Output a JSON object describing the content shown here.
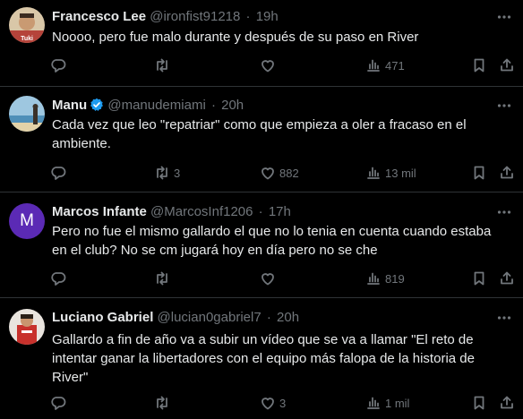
{
  "tweets": [
    {
      "name": "Francesco Lee",
      "handle": "@ironfist91218",
      "time": "19h",
      "verified": false,
      "text": "Noooo, pero fue malo durante y después de su paso en River",
      "replies": "",
      "retweets": "",
      "likes": "",
      "views": "471",
      "avatar": "photo-avatar"
    },
    {
      "name": "Manu",
      "handle": "@manudemiami",
      "time": "20h",
      "verified": true,
      "text": "Cada vez que leo \"repatriar\" como que empieza a oler a fracaso en el ambiente.",
      "replies": "",
      "retweets": "3",
      "likes": "882",
      "views": "13 mil",
      "avatar": "beach-avatar"
    },
    {
      "name": "Marcos Infante",
      "handle": "@MarcosInf1206",
      "time": "17h",
      "verified": false,
      "text": "Pero no fue el mismo gallardo el que no lo tenia en cuenta cuando estaba en el club? No se cm jugará hoy en día pero no se che",
      "replies": "",
      "retweets": "",
      "likes": "",
      "views": "819",
      "avatar": "letter-avatar",
      "avatar_letter": "M",
      "avatar_color": "#5b2ab5"
    },
    {
      "name": "Luciano Gabriel",
      "handle": "@lucian0gabriel7",
      "time": "20h",
      "verified": false,
      "text": "Gallardo a fin de año va a subir un vídeo que se va a llamar \"El reto de intentar ganar la libertadores con el equipo más falopa de la historia de River\"",
      "replies": "",
      "retweets": "",
      "likes": "3",
      "views": "1 mil",
      "avatar": "photo-avatar"
    }
  ],
  "colors": {
    "background": "#000000",
    "text": "#e7e9ea",
    "muted": "#71767b",
    "divider": "#2f3336",
    "verified": "#1d9bf0"
  }
}
